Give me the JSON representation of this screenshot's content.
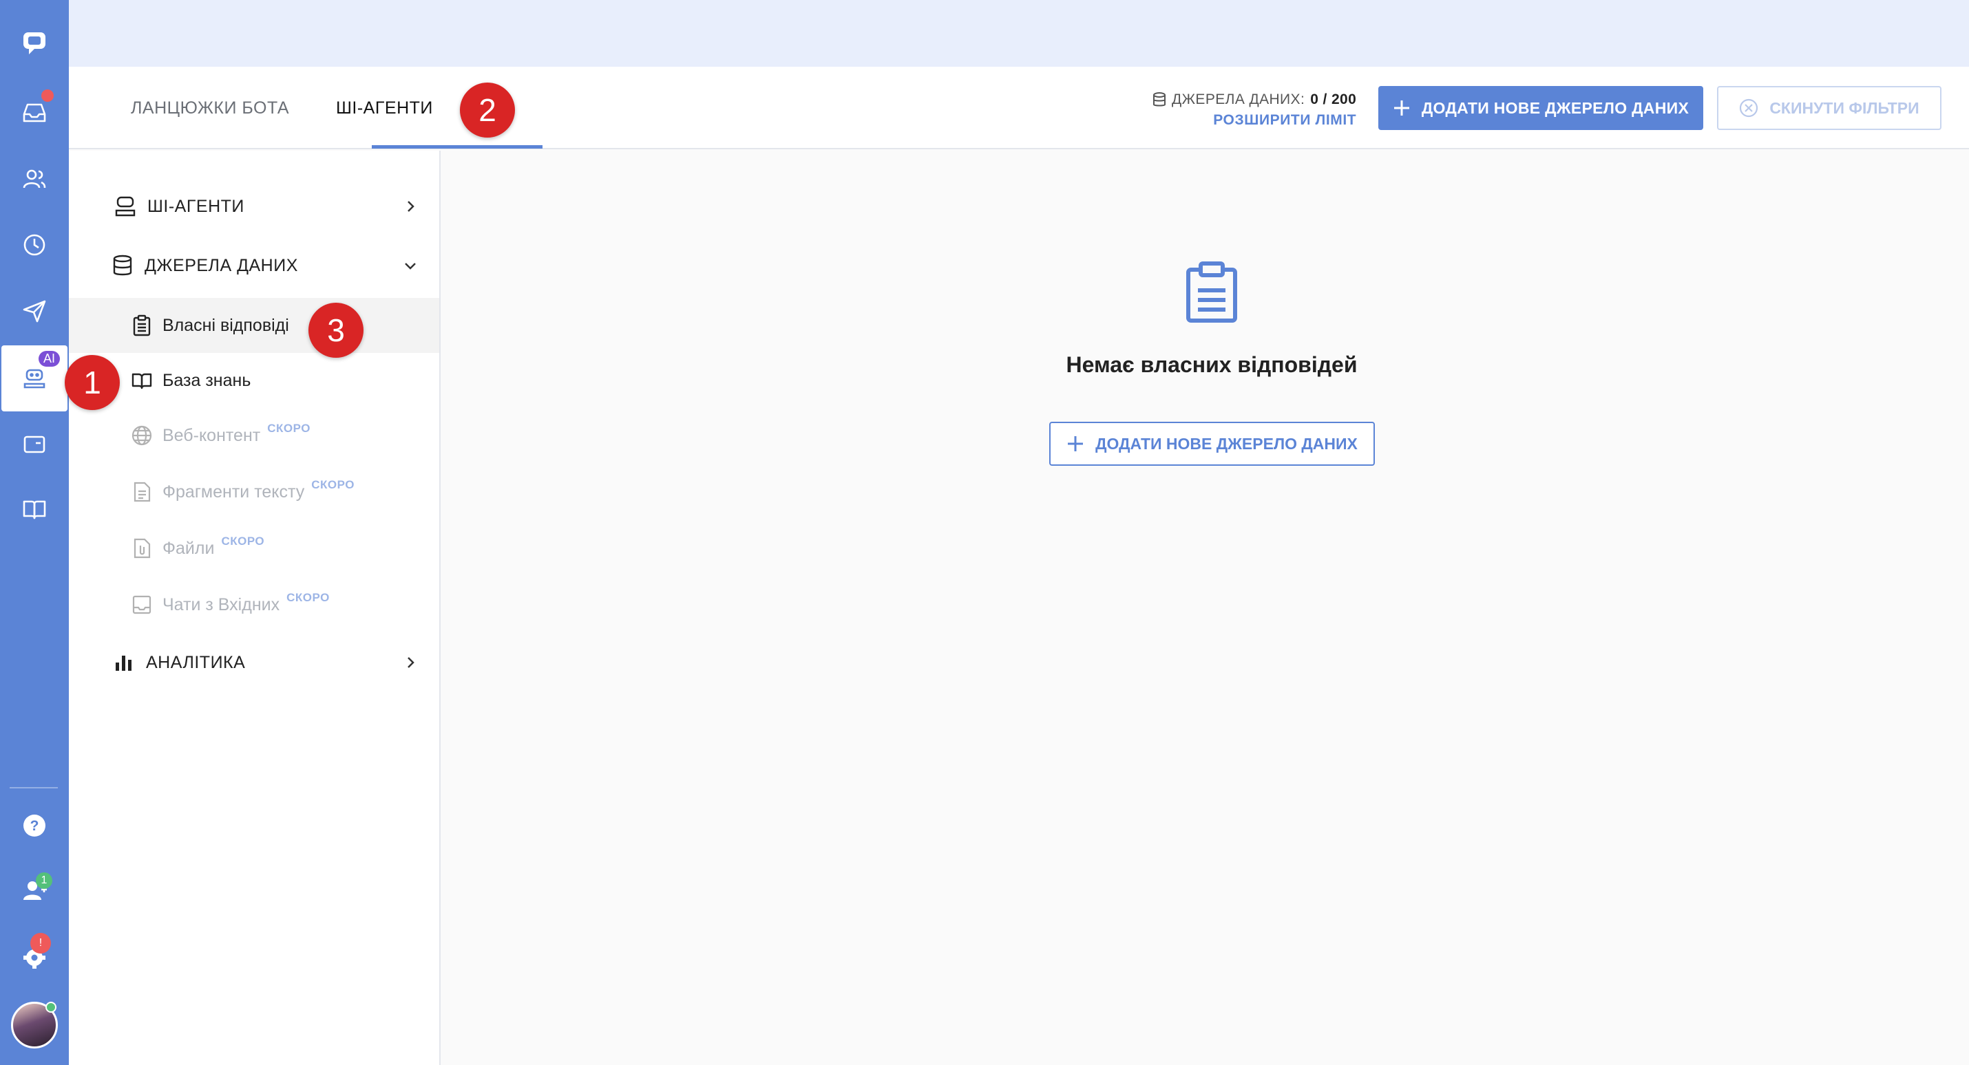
{
  "rail": {
    "ai_badge": "AI",
    "contacts_badge": "1",
    "settings_badge": "!",
    "items": [
      "chat-logo-icon",
      "inbox-icon",
      "contacts-icon",
      "history-icon",
      "send-icon",
      "ai-bot-icon",
      "card-icon",
      "book-icon",
      "help-icon",
      "team-icon",
      "settings-icon"
    ]
  },
  "header": {
    "tabs": [
      {
        "label": "ЛАНЦЮЖКИ БОТА"
      },
      {
        "label": "ШІ-АГЕНТИ"
      }
    ],
    "limit_label": "ДЖЕРЕЛА ДАНИХ:",
    "limit_count": "0 / 200",
    "limit_link": "РОЗШИРИТИ ЛІМІТ",
    "add_button": "ДОДАТИ НОВЕ ДЖЕРЕЛО ДАНИХ",
    "reset_button": "СКИНУТИ ФІЛЬТРИ"
  },
  "markers": [
    "1",
    "2",
    "3"
  ],
  "sidebar": {
    "groups": [
      {
        "label": "ШІ-АГЕНТИ"
      },
      {
        "label": "ДЖЕРЕЛА ДАНИХ"
      },
      {
        "label": "АНАЛІТИКА"
      }
    ],
    "subitems": [
      {
        "label": "Власні відповіді"
      },
      {
        "label": "База знань"
      },
      {
        "label": "Веб-контент",
        "soon": "СКОРО"
      },
      {
        "label": "Фрагменти тексту",
        "soon": "СКОРО"
      },
      {
        "label": "Файли",
        "soon": "СКОРО"
      },
      {
        "label": "Чати з Вхідних",
        "soon": "СКОРО"
      }
    ]
  },
  "main": {
    "empty_title": "Немає власних відповідей",
    "empty_button": "ДОДАТИ НОВЕ ДЖЕРЕЛО ДАНИХ"
  },
  "colors": {
    "accent": "#5b84d6",
    "rail": "#5b84d6",
    "marker": "#d92525",
    "badge_purple": "#7b4fd6",
    "badge_green": "#54c07a",
    "badge_red": "#ef5a5a"
  }
}
